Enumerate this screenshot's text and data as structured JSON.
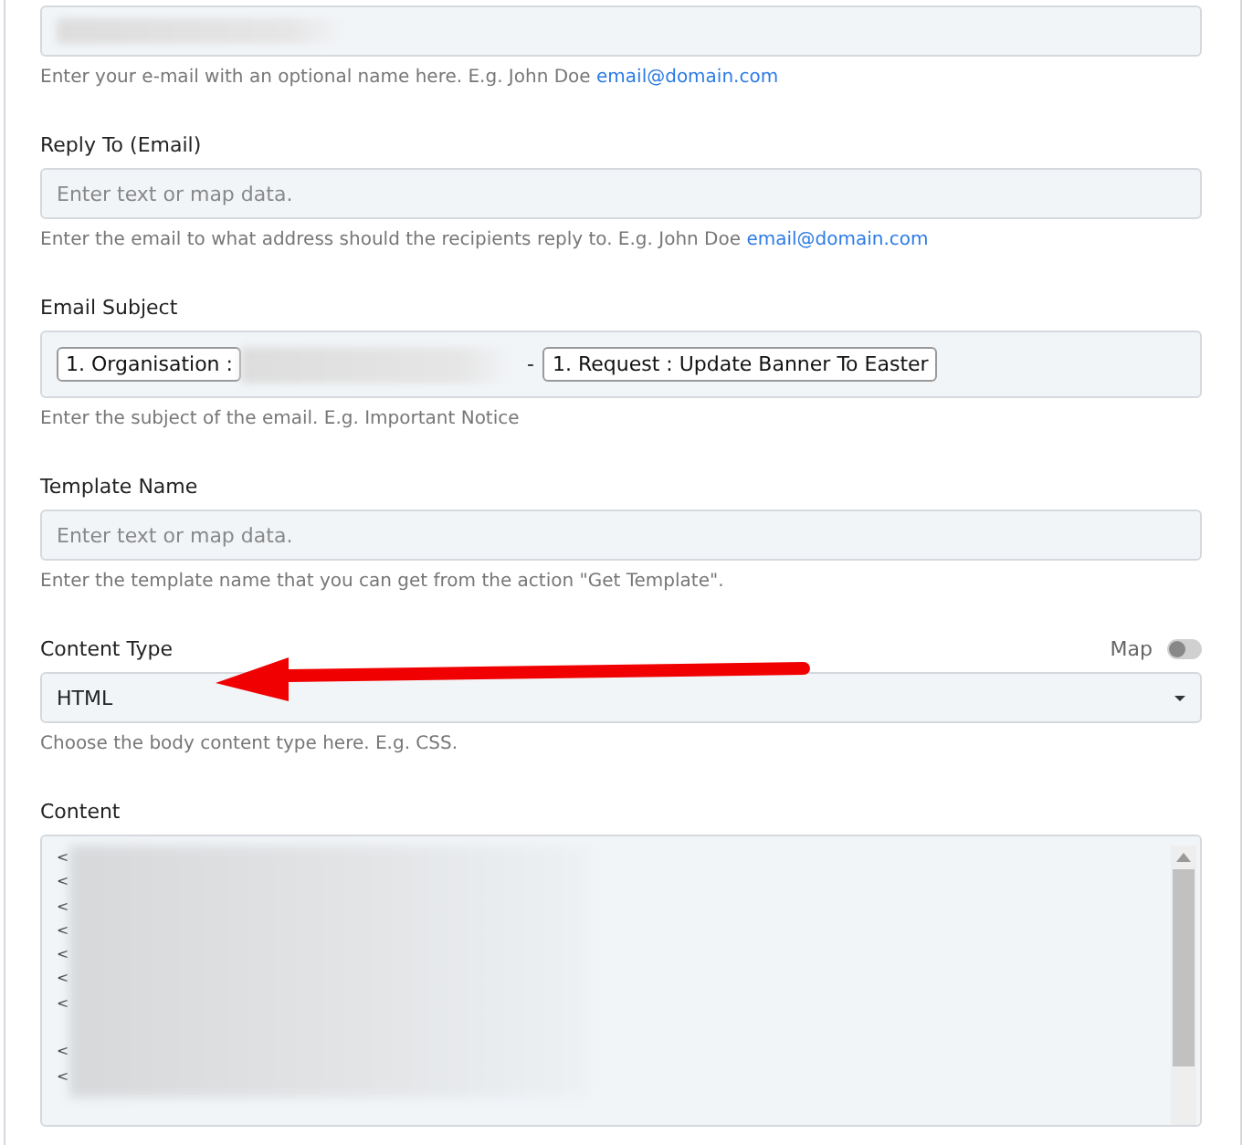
{
  "fields": [
    {
      "kind": "redacted",
      "help": "Enter your e-mail with an optional name here. E.g. John Doe",
      "help_link": "email@domain.com"
    },
    {
      "kind": "text",
      "label": "Reply To (Email)",
      "placeholder": "Enter text or map data.",
      "help": "Enter the email to what address should the recipients reply to. E.g. John Doe",
      "help_link": "email@domain.com"
    },
    {
      "kind": "tokens",
      "label": "Email Subject",
      "parts": [
        {
          "kind": "token",
          "text": "1. Organisation :"
        },
        {
          "kind": "redacted"
        },
        {
          "kind": "text",
          "text": "-"
        },
        {
          "kind": "token",
          "text": "1. Request : Update Banner To Easter"
        }
      ],
      "help": "Enter the subject of the email. E.g. Important Notice"
    },
    {
      "kind": "text",
      "label": "Template Name",
      "placeholder": "Enter text or map data.",
      "help": "Enter the template name that you can get from the action \"Get Template\"."
    },
    {
      "kind": "select",
      "label": "Content Type",
      "map": {
        "label": "Map",
        "on": false
      },
      "value": "HTML",
      "help": "Choose the body content type here. E.g. CSS."
    },
    {
      "kind": "textarea",
      "label": "Content",
      "lines": [
        {
          "kind": "code",
          "text": "<"
        },
        {
          "kind": "code",
          "text": "<"
        },
        {
          "kind": "code",
          "text": "<"
        },
        {
          "kind": "code",
          "text": "<"
        },
        {
          "kind": "code",
          "text": "<"
        },
        {
          "kind": "code",
          "text": "<"
        },
        {
          "kind": "code",
          "text": "<"
        },
        {
          "kind": "blank"
        },
        {
          "kind": "code",
          "text": "<"
        },
        {
          "kind": "code",
          "text": "<"
        }
      ]
    }
  ]
}
